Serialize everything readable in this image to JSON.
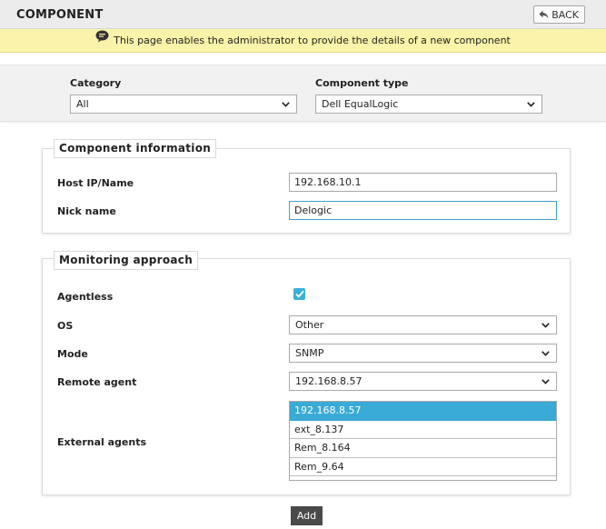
{
  "header": {
    "title": "COMPONENT",
    "back_label": "BACK"
  },
  "notice": {
    "text": "This page enables the administrator to provide the details of a new component"
  },
  "selectors": {
    "category_label": "Category",
    "category_value": "All",
    "type_label": "Component type",
    "type_value": "Dell EqualLogic"
  },
  "component_info": {
    "legend": "Component information",
    "host_label": "Host IP/Name",
    "host_value": "192.168.10.1",
    "nick_label": "Nick name",
    "nick_value": "Delogic"
  },
  "monitoring": {
    "legend": "Monitoring approach",
    "agentless_label": "Agentless",
    "agentless_checked": true,
    "os_label": "OS",
    "os_value": "Other",
    "mode_label": "Mode",
    "mode_value": "SNMP",
    "remote_label": "Remote agent",
    "remote_value": "192.168.8.57",
    "external_label": "External agents",
    "external_agents": [
      "192.168.8.57",
      "ext_8.137",
      "Rem_8.164",
      "Rem_9.64"
    ]
  },
  "actions": {
    "add_label": "Add"
  },
  "colors": {
    "accent": "#3aaad6",
    "notice_bg": "#faf3a9",
    "button_dark": "#4a4a4a"
  }
}
